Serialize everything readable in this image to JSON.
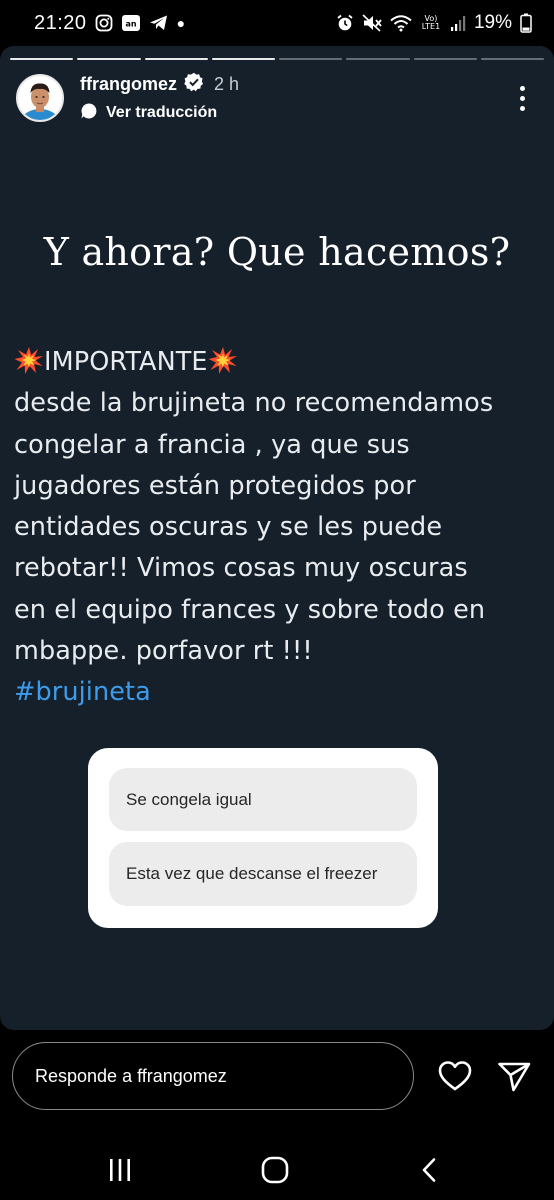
{
  "status_bar": {
    "time": "21:20",
    "network_label": "Vo) LTE1",
    "battery_percent": "19%",
    "left_icons": [
      "instagram-icon",
      "media-icon",
      "telegram-icon",
      "dot"
    ],
    "right_icons": [
      "alarm-icon",
      "mute-icon",
      "wifi-icon",
      "signal-icon",
      "battery-icon"
    ]
  },
  "story": {
    "progress": {
      "segments": 8,
      "current_index": 4
    },
    "user": {
      "username": "ffrangomez",
      "verified": true,
      "time_ago": "2 h",
      "translate_label": "Ver traducción"
    },
    "headline": "Y ahora? Que hacemos?",
    "body": {
      "title": "IMPORTANTE",
      "lines": [
        "desde la brujineta no recomendamos",
        "congelar a francia , ya que sus",
        "jugadores están protegidos por",
        "entidades oscuras y se les puede",
        "rebotar!! Vimos cosas muy oscuras",
        "en el equipo frances y sobre todo en",
        "mbappe. porfavor rt !!!"
      ],
      "hashtag": "#brujineta"
    },
    "poll": {
      "options": [
        {
          "label": "Se congela igual"
        },
        {
          "label": "Esta vez que descanse el freezer"
        }
      ]
    }
  },
  "reply": {
    "placeholder": "Responde a ffrangomez"
  },
  "nav": {
    "buttons": [
      "recents-icon",
      "home-icon",
      "back-icon"
    ]
  },
  "colors": {
    "story_background": "#16202b",
    "hashtag": "#3d9be9",
    "verified_badge": "#ffffff",
    "burst": "#ff4d2e"
  }
}
